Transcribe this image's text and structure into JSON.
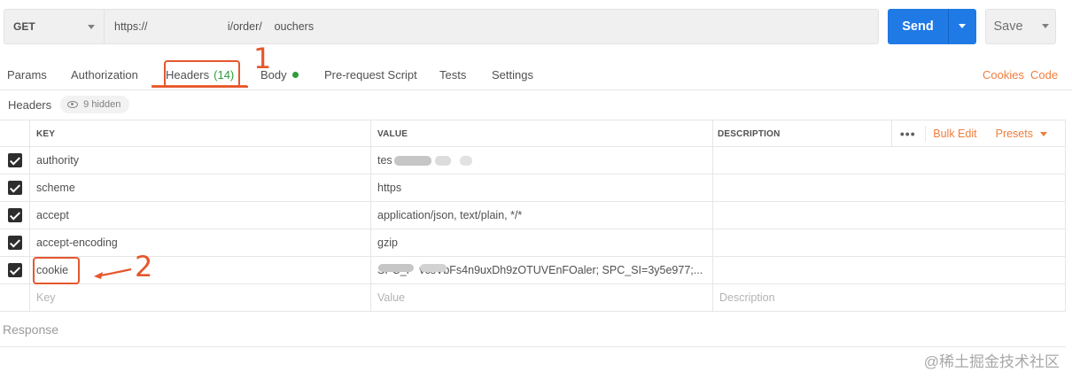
{
  "request": {
    "method": "GET",
    "url": "https://                          i/order/    ouchers",
    "send_label": "Send",
    "save_label": "Save"
  },
  "tabs": [
    {
      "label": "Params"
    },
    {
      "label": "Authorization"
    },
    {
      "label": "Headers",
      "count": "(14)"
    },
    {
      "label": "Body"
    },
    {
      "label": "Pre-request Script"
    },
    {
      "label": "Tests"
    },
    {
      "label": "Settings"
    }
  ],
  "tab_links": {
    "cookies": "Cookies",
    "code": "Code"
  },
  "headers_section": {
    "label": "Headers",
    "hidden": "9 hidden"
  },
  "table": {
    "columns": {
      "key": "KEY",
      "value": "VALUE",
      "description": "DESCRIPTION"
    },
    "bulk_edit": "Bulk Edit",
    "presets": "Presets",
    "rows": [
      {
        "key": "authority",
        "value": "tes",
        "checked": true
      },
      {
        "key": "scheme",
        "value": "https",
        "checked": true
      },
      {
        "key": "accept",
        "value": "application/json, text/plain, */*",
        "checked": true
      },
      {
        "key": "accept-encoding",
        "value": "gzip",
        "checked": true
      },
      {
        "key": "cookie",
        "value": "SPC_F  vcsVbFs4n9uxDh9zOTUVEnFOaler; SPC_SI=3y5e977;...",
        "checked": true
      }
    ],
    "placeholders": {
      "key": "Key",
      "value": "Value",
      "description": "Description"
    }
  },
  "response_label": "Response",
  "annotations": {
    "one": "1",
    "two": "2"
  },
  "watermark": "@稀土掘金技术社区",
  "colors": {
    "accent": "#f07c3d",
    "send": "#1f7ae6",
    "annotation": "#e5572d",
    "count_green": "#2b9d3b"
  }
}
